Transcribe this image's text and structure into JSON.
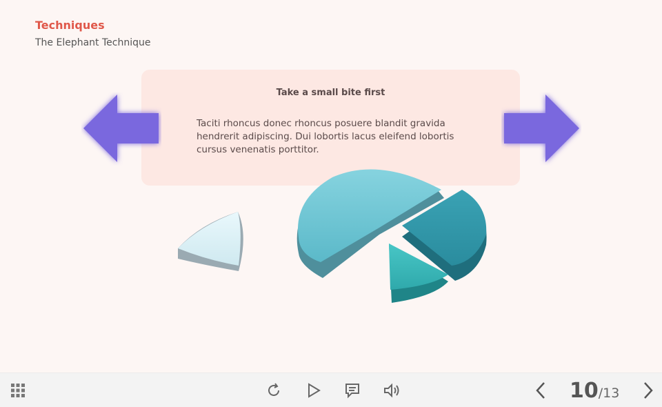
{
  "slide": {
    "title": "Techniques",
    "subtitle": "The Elephant Technique",
    "card": {
      "heading": "Take a small bite first",
      "body": "Taciti rhoncus donec rhoncus posuere blandit gravida hendrerit adipiscing. Dui lobortis lacus eleifend lobortis cursus venenatis porttitor."
    },
    "colors": {
      "accent_title": "#e0584a",
      "arrow": "#7a68de",
      "card_bg": "#fde8e3",
      "pie_light": "#dff3f8",
      "pie_main": "#6ec8d6",
      "pie_dark": "#2d93a6",
      "pie_teal": "#35b6b6"
    },
    "nav_icons": {
      "left": "arrow-left-icon",
      "right": "arrow-right-icon"
    }
  },
  "toolbar": {
    "icons": {
      "menu": "grid-icon",
      "replay": "replay-icon",
      "play": "play-icon",
      "notes": "notes-icon",
      "volume": "volume-icon",
      "prev": "chevron-left-icon",
      "next": "chevron-right-icon"
    },
    "page": {
      "current": "10",
      "separator": "/",
      "total": "13"
    }
  }
}
